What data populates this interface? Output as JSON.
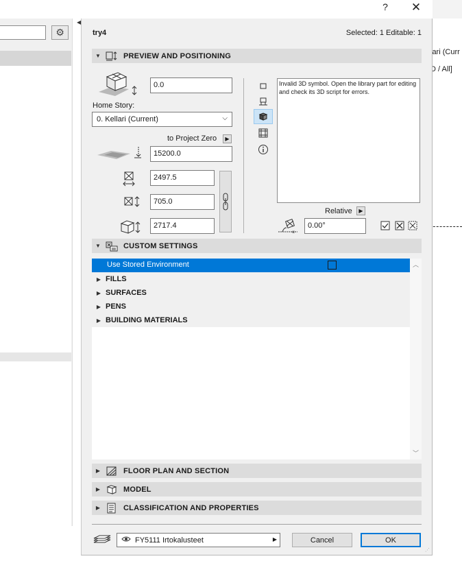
{
  "window": {
    "help_label": "?",
    "close_label": "✕",
    "object_name": "try4",
    "selection_info": "Selected: 1 Editable: 1"
  },
  "background": {
    "right_text_1": "lari (Curr",
    "right_text_2": "D / All]"
  },
  "preview": {
    "section_title": "PREVIEW AND POSITIONING",
    "elevation_value": "0.0",
    "home_story_label": "Home Story:",
    "home_story_value": "0. Kellari (Current)",
    "to_project_zero_label": "to Project Zero",
    "project_zero_value": "15200.0",
    "width_value": "2497.5",
    "depth_value": "705.0",
    "height_value": "2717.4",
    "preview_message": "Invalid 3D symbol. Open the library part for editing and check its 3D script for errors.",
    "relative_label": "Relative",
    "angle_value": "0.00°"
  },
  "custom_settings": {
    "section_title": "CUSTOM SETTINGS",
    "selected_row": "Use Stored Environment",
    "groups": [
      "FILLS",
      "SURFACES",
      "PENS",
      "BUILDING MATERIALS"
    ]
  },
  "collapsed_sections": [
    "FLOOR PLAN AND SECTION",
    "MODEL",
    "CLASSIFICATION AND PROPERTIES"
  ],
  "footer": {
    "layer_value": "FY5111 Irtokalusteet",
    "cancel_label": "Cancel",
    "ok_label": "OK"
  },
  "colors": {
    "selection": "#0078d7",
    "section_header": "#dcdcdc",
    "dialog_bg": "#f0f0f0"
  },
  "icons": [
    "settings-gear-icon",
    "close-icon",
    "help-icon",
    "preview-section-icon",
    "custom-settings-icon",
    "floor-plan-icon",
    "model-icon",
    "classification-icon",
    "layer-icon",
    "eye-icon",
    "link-icon",
    "info-icon"
  ]
}
